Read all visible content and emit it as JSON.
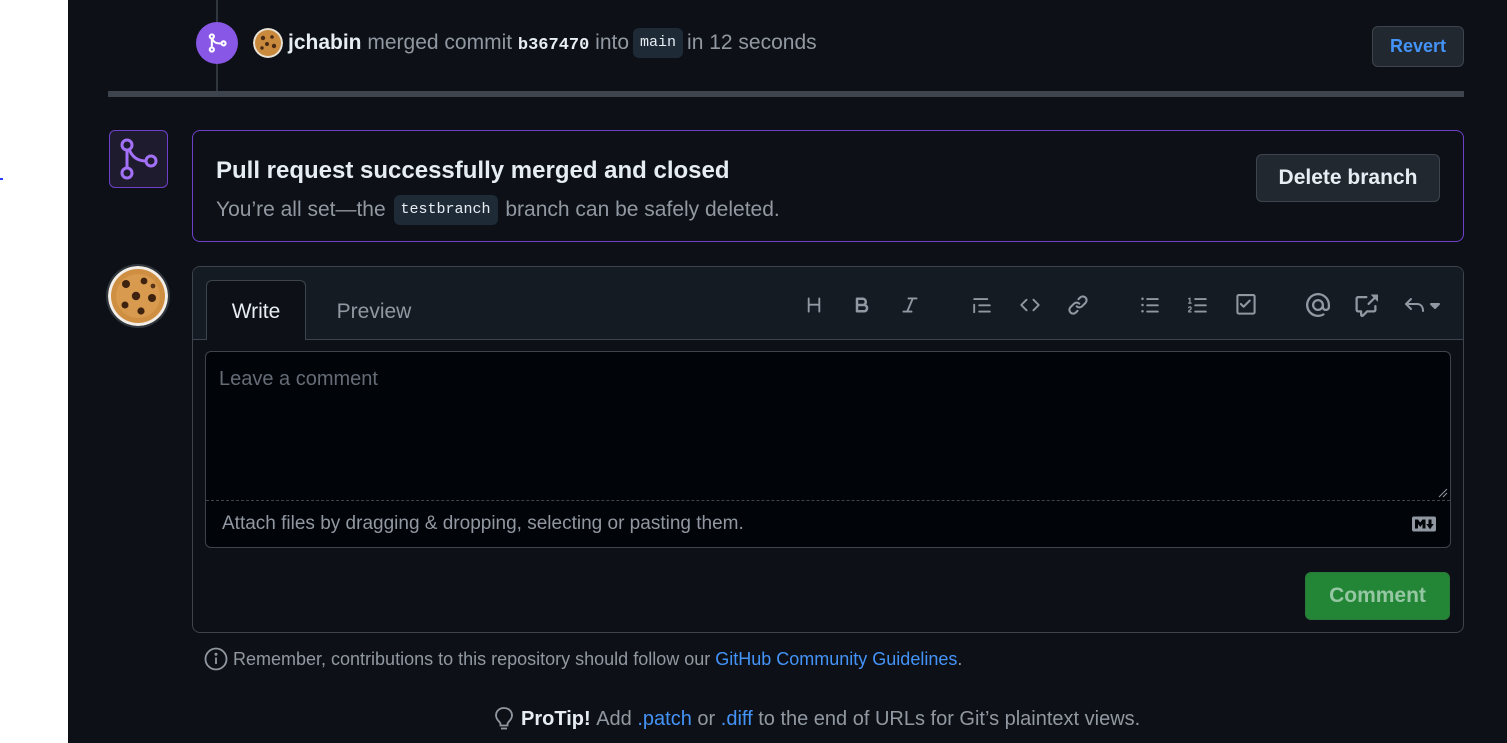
{
  "timeline_event": {
    "author": "jchabin",
    "action": "merged commit",
    "commit_sha": "b367470",
    "into_text": "into",
    "target_branch": "main",
    "time_text": "in 12 seconds",
    "revert_label": "Revert"
  },
  "merge_status": {
    "title": "Pull request successfully merged and closed",
    "subtitle_prefix": "You’re all set—the",
    "branch_name": "testbranch",
    "subtitle_suffix": "branch can be safely deleted.",
    "delete_branch_label": "Delete branch"
  },
  "composer": {
    "tabs": [
      {
        "label": "Write",
        "selected": true
      },
      {
        "label": "Preview",
        "selected": false
      }
    ],
    "toolbar_icons": [
      "heading-icon",
      "bold-icon",
      "italic-icon",
      "quote-icon",
      "code-icon",
      "link-icon",
      "unordered-list-icon",
      "ordered-list-icon",
      "task-list-icon",
      "mention-icon",
      "cross-reference-icon",
      "saved-replies-icon"
    ],
    "placeholder": "Leave a comment",
    "value": "",
    "attach_text": "Attach files by dragging & dropping, selecting or pasting them.",
    "comment_label": "Comment"
  },
  "footer": {
    "guidelines_prefix": "Remember, contributions to this repository should follow our",
    "guidelines_link": "GitHub Community Guidelines",
    "guidelines_suffix": ".",
    "protip_label": "ProTip!",
    "protip_add": "Add",
    "protip_patch": ".patch",
    "protip_or": "or",
    "protip_diff": ".diff",
    "protip_suffix": "to the end of URLs for Git’s plaintext views."
  },
  "colors": {
    "background": "#0d1117",
    "merged_purple": "#8957e5",
    "link_blue": "#4493f8",
    "comment_green": "#238636"
  }
}
